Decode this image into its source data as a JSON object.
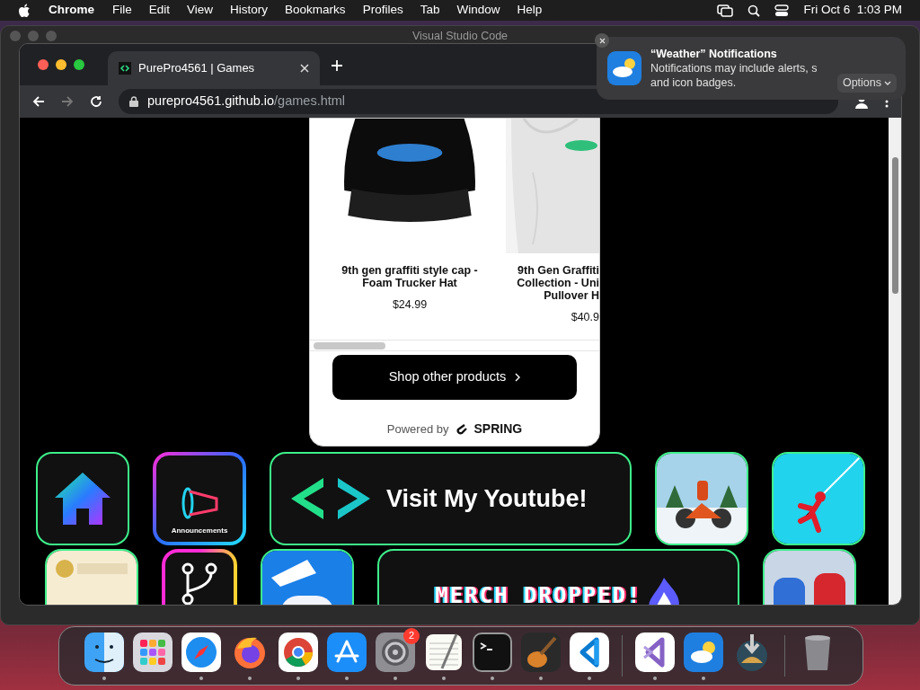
{
  "menu_bar": {
    "app": "Chrome",
    "items": [
      "File",
      "Edit",
      "View",
      "History",
      "Bookmarks",
      "Profiles",
      "Tab",
      "Window",
      "Help"
    ],
    "date": "Fri Oct 6",
    "time": "1:03 PM"
  },
  "background_window": {
    "title": "Visual Studio Code"
  },
  "browser": {
    "tabs": [
      {
        "title": "PurePro4561 | Games",
        "selected": true
      }
    ],
    "url_host": "purepro4561.github.io",
    "url_path": "/games.html"
  },
  "shop": {
    "products": [
      {
        "name_lines": [
          "9th gen graffiti style cap -",
          "Foam Trucker Hat"
        ],
        "price": "$24.99",
        "kind": "cap"
      },
      {
        "name_lines": [
          "9th Gen Graffiti",
          "Collection - Uni",
          "Pullover H"
        ],
        "price": "$40.9",
        "kind": "hoodie"
      }
    ],
    "button": "Shop other products",
    "powered_by": "Powered by",
    "brand": "SPRING"
  },
  "tiles": [
    {
      "kind": "home"
    },
    {
      "kind": "announce",
      "label": "Announcements"
    },
    {
      "kind": "youtube",
      "label": "Visit My Youtube!"
    },
    {
      "kind": "moto"
    },
    {
      "kind": "stickman"
    },
    {
      "kind": "doge"
    },
    {
      "kind": "git"
    },
    {
      "kind": "fall"
    },
    {
      "kind": "merch",
      "label": "MERCH DROPPED!"
    },
    {
      "kind": "fighters"
    }
  ],
  "notification": {
    "title": "“Weather” Notifications",
    "body": "Notifications may include alerts, s",
    "body_2": "and icon badges.",
    "button": "Options"
  },
  "dock": [
    {
      "kind": "finder",
      "running": true
    },
    {
      "kind": "launchpad",
      "running": false
    },
    {
      "kind": "safari",
      "running": true
    },
    {
      "kind": "firefox",
      "running": true
    },
    {
      "kind": "chrome",
      "running": true
    },
    {
      "kind": "appstore",
      "running": true
    },
    {
      "kind": "settings",
      "running": true,
      "badge": "2"
    },
    {
      "kind": "textedit",
      "running": true
    },
    {
      "kind": "terminal",
      "running": true
    },
    {
      "kind": "garageband",
      "running": true
    },
    {
      "kind": "vscode",
      "running": true
    },
    {
      "kind": "sep"
    },
    {
      "kind": "vs",
      "running": true
    },
    {
      "kind": "weather",
      "running": true
    },
    {
      "kind": "download",
      "running": false
    },
    {
      "kind": "sep"
    },
    {
      "kind": "trash",
      "running": false
    }
  ]
}
